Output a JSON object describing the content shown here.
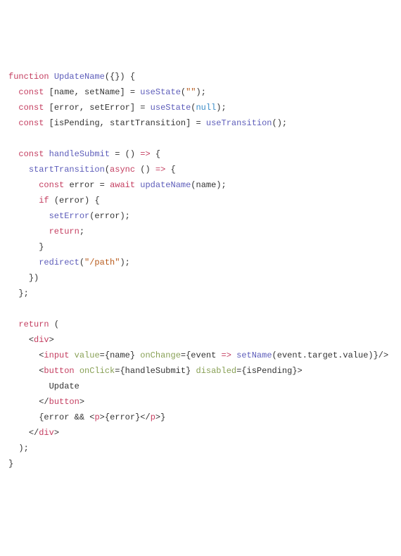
{
  "code": {
    "lines": [
      {
        "indent": 0,
        "tokens": [
          {
            "c": "keyword",
            "t": "function"
          },
          {
            "c": "punc",
            "t": " "
          },
          {
            "c": "func",
            "t": "UpdateName"
          },
          {
            "c": "punc",
            "t": "({}) {"
          }
        ]
      },
      {
        "indent": 1,
        "tokens": [
          {
            "c": "keyword",
            "t": "const"
          },
          {
            "c": "punc",
            "t": " ["
          },
          {
            "c": "ident",
            "t": "name"
          },
          {
            "c": "punc",
            "t": ", "
          },
          {
            "c": "ident",
            "t": "setName"
          },
          {
            "c": "punc",
            "t": "] = "
          },
          {
            "c": "func",
            "t": "useState"
          },
          {
            "c": "punc",
            "t": "("
          },
          {
            "c": "string",
            "t": "\"\""
          },
          {
            "c": "punc",
            "t": ");"
          }
        ]
      },
      {
        "indent": 1,
        "tokens": [
          {
            "c": "keyword",
            "t": "const"
          },
          {
            "c": "punc",
            "t": " ["
          },
          {
            "c": "ident",
            "t": "error"
          },
          {
            "c": "punc",
            "t": ", "
          },
          {
            "c": "ident",
            "t": "setError"
          },
          {
            "c": "punc",
            "t": "] = "
          },
          {
            "c": "func",
            "t": "useState"
          },
          {
            "c": "punc",
            "t": "("
          },
          {
            "c": "const",
            "t": "null"
          },
          {
            "c": "punc",
            "t": ");"
          }
        ]
      },
      {
        "indent": 1,
        "tokens": [
          {
            "c": "keyword",
            "t": "const"
          },
          {
            "c": "punc",
            "t": " ["
          },
          {
            "c": "ident",
            "t": "isPending"
          },
          {
            "c": "punc",
            "t": ", "
          },
          {
            "c": "ident",
            "t": "startTransition"
          },
          {
            "c": "punc",
            "t": "] = "
          },
          {
            "c": "func",
            "t": "useTransition"
          },
          {
            "c": "punc",
            "t": "();"
          }
        ]
      },
      {
        "indent": 0,
        "tokens": []
      },
      {
        "indent": 1,
        "tokens": [
          {
            "c": "keyword",
            "t": "const"
          },
          {
            "c": "punc",
            "t": " "
          },
          {
            "c": "func",
            "t": "handleSubmit"
          },
          {
            "c": "punc",
            "t": " = () "
          },
          {
            "c": "keyword",
            "t": "=>"
          },
          {
            "c": "punc",
            "t": " {"
          }
        ]
      },
      {
        "indent": 2,
        "tokens": [
          {
            "c": "func",
            "t": "startTransition"
          },
          {
            "c": "punc",
            "t": "("
          },
          {
            "c": "keyword",
            "t": "async"
          },
          {
            "c": "punc",
            "t": " () "
          },
          {
            "c": "keyword",
            "t": "=>"
          },
          {
            "c": "punc",
            "t": " {"
          }
        ]
      },
      {
        "indent": 3,
        "tokens": [
          {
            "c": "keyword",
            "t": "const"
          },
          {
            "c": "punc",
            "t": " "
          },
          {
            "c": "ident",
            "t": "error"
          },
          {
            "c": "punc",
            "t": " = "
          },
          {
            "c": "keyword",
            "t": "await"
          },
          {
            "c": "punc",
            "t": " "
          },
          {
            "c": "func",
            "t": "updateName"
          },
          {
            "c": "punc",
            "t": "("
          },
          {
            "c": "ident",
            "t": "name"
          },
          {
            "c": "punc",
            "t": ");"
          }
        ]
      },
      {
        "indent": 3,
        "tokens": [
          {
            "c": "keyword",
            "t": "if"
          },
          {
            "c": "punc",
            "t": " ("
          },
          {
            "c": "ident",
            "t": "error"
          },
          {
            "c": "punc",
            "t": ") {"
          }
        ]
      },
      {
        "indent": 4,
        "tokens": [
          {
            "c": "func",
            "t": "setError"
          },
          {
            "c": "punc",
            "t": "("
          },
          {
            "c": "ident",
            "t": "error"
          },
          {
            "c": "punc",
            "t": ");"
          }
        ]
      },
      {
        "indent": 4,
        "tokens": [
          {
            "c": "keyword",
            "t": "return"
          },
          {
            "c": "punc",
            "t": ";"
          }
        ]
      },
      {
        "indent": 3,
        "tokens": [
          {
            "c": "punc",
            "t": "}"
          }
        ]
      },
      {
        "indent": 3,
        "tokens": [
          {
            "c": "func",
            "t": "redirect"
          },
          {
            "c": "punc",
            "t": "("
          },
          {
            "c": "string",
            "t": "\"/path\""
          },
          {
            "c": "punc",
            "t": ");"
          }
        ]
      },
      {
        "indent": 2,
        "tokens": [
          {
            "c": "punc",
            "t": "})"
          }
        ]
      },
      {
        "indent": 1,
        "tokens": [
          {
            "c": "punc",
            "t": "};"
          }
        ]
      },
      {
        "indent": 0,
        "tokens": []
      },
      {
        "indent": 1,
        "tokens": [
          {
            "c": "keyword",
            "t": "return"
          },
          {
            "c": "punc",
            "t": " ("
          }
        ]
      },
      {
        "indent": 2,
        "tokens": [
          {
            "c": "punc",
            "t": "<"
          },
          {
            "c": "tagname",
            "t": "div"
          },
          {
            "c": "punc",
            "t": ">"
          }
        ]
      },
      {
        "indent": 3,
        "tokens": [
          {
            "c": "punc",
            "t": "<"
          },
          {
            "c": "tagname",
            "t": "input"
          },
          {
            "c": "punc",
            "t": " "
          },
          {
            "c": "attr",
            "t": "value"
          },
          {
            "c": "punc",
            "t": "={"
          },
          {
            "c": "ident",
            "t": "name"
          },
          {
            "c": "punc",
            "t": "} "
          },
          {
            "c": "attr",
            "t": "onChange"
          },
          {
            "c": "punc",
            "t": "={"
          },
          {
            "c": "ident",
            "t": "event"
          },
          {
            "c": "punc",
            "t": " "
          },
          {
            "c": "keyword",
            "t": "=>"
          },
          {
            "c": "punc",
            "t": " "
          },
          {
            "c": "func",
            "t": "setName"
          },
          {
            "c": "punc",
            "t": "("
          },
          {
            "c": "ident",
            "t": "event"
          },
          {
            "c": "punc",
            "t": "."
          },
          {
            "c": "ident",
            "t": "target"
          },
          {
            "c": "punc",
            "t": "."
          },
          {
            "c": "ident",
            "t": "value"
          },
          {
            "c": "punc",
            "t": ")}/>"
          }
        ]
      },
      {
        "indent": 3,
        "tokens": [
          {
            "c": "punc",
            "t": "<"
          },
          {
            "c": "tagname",
            "t": "button"
          },
          {
            "c": "punc",
            "t": " "
          },
          {
            "c": "attr",
            "t": "onClick"
          },
          {
            "c": "punc",
            "t": "={"
          },
          {
            "c": "ident",
            "t": "handleSubmit"
          },
          {
            "c": "punc",
            "t": "} "
          },
          {
            "c": "attr",
            "t": "disabled"
          },
          {
            "c": "punc",
            "t": "={"
          },
          {
            "c": "ident",
            "t": "isPending"
          },
          {
            "c": "punc",
            "t": "}>"
          }
        ]
      },
      {
        "indent": 4,
        "tokens": [
          {
            "c": "ident",
            "t": "Update"
          }
        ]
      },
      {
        "indent": 3,
        "tokens": [
          {
            "c": "punc",
            "t": "</"
          },
          {
            "c": "tagname",
            "t": "button"
          },
          {
            "c": "punc",
            "t": ">"
          }
        ]
      },
      {
        "indent": 3,
        "tokens": [
          {
            "c": "punc",
            "t": "{"
          },
          {
            "c": "ident",
            "t": "error"
          },
          {
            "c": "punc",
            "t": " && <"
          },
          {
            "c": "tagname",
            "t": "p"
          },
          {
            "c": "punc",
            "t": ">{"
          },
          {
            "c": "ident",
            "t": "error"
          },
          {
            "c": "punc",
            "t": "}</"
          },
          {
            "c": "tagname",
            "t": "p"
          },
          {
            "c": "punc",
            "t": ">}"
          }
        ]
      },
      {
        "indent": 2,
        "tokens": [
          {
            "c": "punc",
            "t": "</"
          },
          {
            "c": "tagname",
            "t": "div"
          },
          {
            "c": "punc",
            "t": ">"
          }
        ]
      },
      {
        "indent": 1,
        "tokens": [
          {
            "c": "punc",
            "t": ");"
          }
        ]
      },
      {
        "indent": 0,
        "tokens": [
          {
            "c": "punc",
            "t": "}"
          }
        ]
      }
    ],
    "indentUnit": "  "
  }
}
